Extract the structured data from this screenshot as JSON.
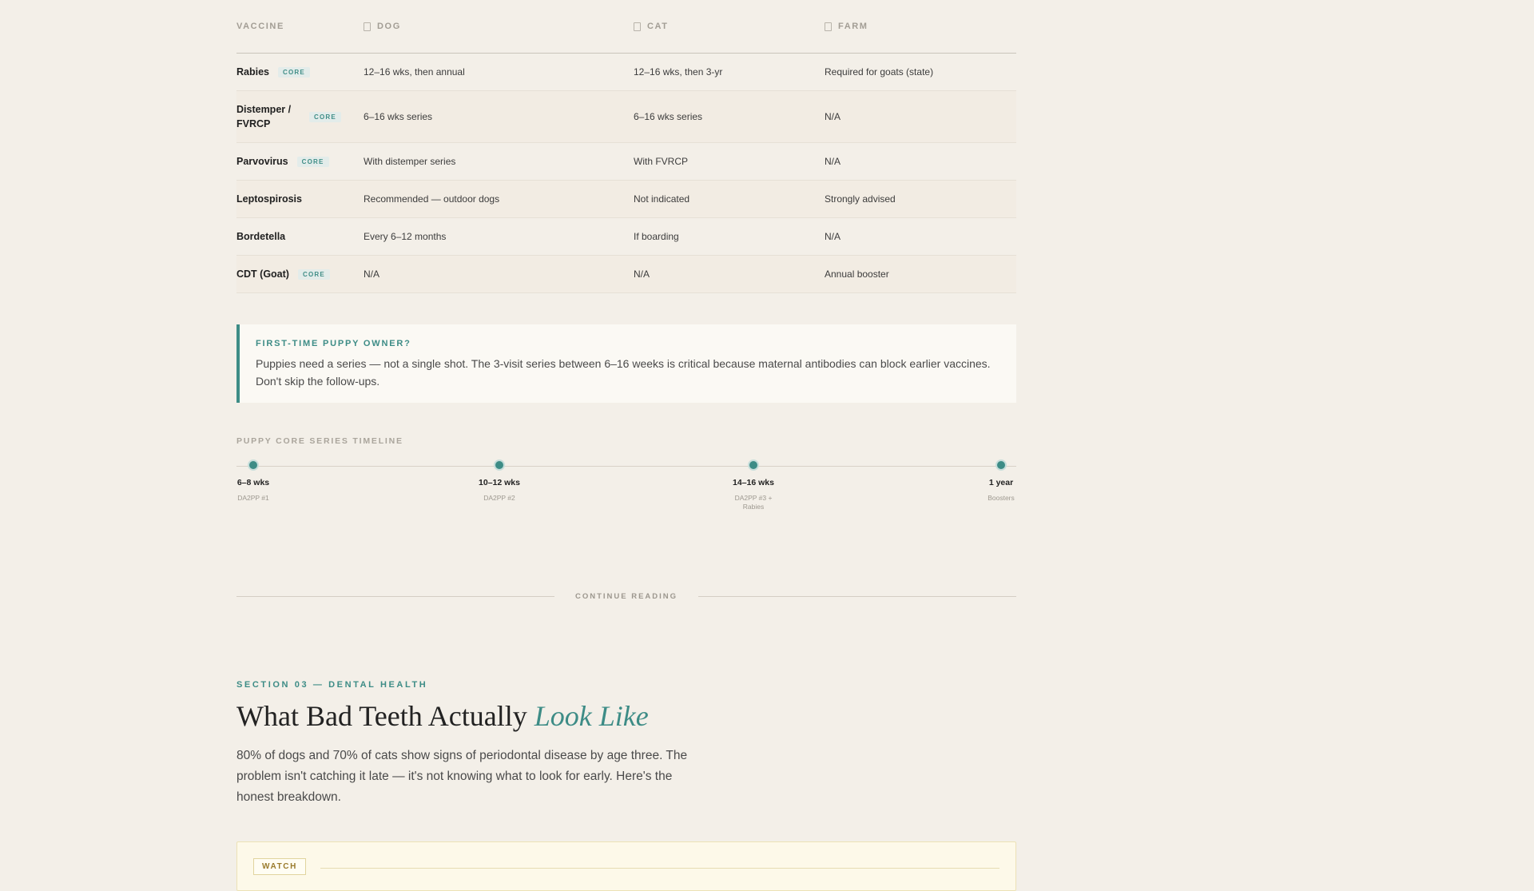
{
  "table": {
    "headers": {
      "vaccine": "VACCINE",
      "dog": "DOG",
      "cat": "CAT",
      "farm": "FARM"
    },
    "core_label": "CORE",
    "rows": [
      {
        "name": "Rabies",
        "core": true,
        "dog": "12–16 wks, then annual",
        "cat": "12–16 wks, then 3-yr",
        "farm": "Required for goats (state)"
      },
      {
        "name": "Distemper / FVRCP",
        "core": true,
        "dog": "6–16 wks series",
        "cat": "6–16 wks series",
        "farm": "N/A"
      },
      {
        "name": "Parvovirus",
        "core": true,
        "dog": "With distemper series",
        "cat": "With FVRCP",
        "farm": "N/A"
      },
      {
        "name": "Leptospirosis",
        "core": false,
        "dog": "Recommended — outdoor dogs",
        "cat": "Not indicated",
        "farm": "Strongly advised"
      },
      {
        "name": "Bordetella",
        "core": false,
        "dog": "Every 6–12 months",
        "cat": "If boarding",
        "farm": "N/A"
      },
      {
        "name": "CDT (Goat)",
        "core": true,
        "dog": "N/A",
        "cat": "N/A",
        "farm": "Annual booster"
      }
    ]
  },
  "callout": {
    "title": "FIRST-TIME PUPPY OWNER?",
    "text": "Puppies need a series — not a single shot. The 3-visit series between 6–16 weeks is critical because maternal antibodies can block earlier vaccines. Don't skip the follow-ups."
  },
  "timeline": {
    "label": "PUPPY CORE SERIES TIMELINE",
    "items": [
      {
        "time": "6–8 wks",
        "desc": "DA2PP #1"
      },
      {
        "time": "10–12 wks",
        "desc": "DA2PP #2"
      },
      {
        "time": "14–16 wks",
        "desc": "DA2PP #3 + Rabies"
      },
      {
        "time": "1 year",
        "desc": "Boosters"
      }
    ]
  },
  "divider": {
    "label": "CONTINUE READING"
  },
  "section": {
    "eyebrow": "SECTION 03 — DENTAL HEALTH",
    "headline_plain": "What Bad Teeth Actually ",
    "headline_accent": "Look Like",
    "lede": "80% of dogs and 70% of cats show signs of periodontal disease by age three. The problem isn't catching it late — it's not knowing what to look for early. Here's the honest breakdown."
  },
  "watch_card": {
    "badge": "WATCH"
  },
  "colors": {
    "accent": "#3d8c86",
    "background": "#f3efe8",
    "watch": "#9a7b2c"
  }
}
